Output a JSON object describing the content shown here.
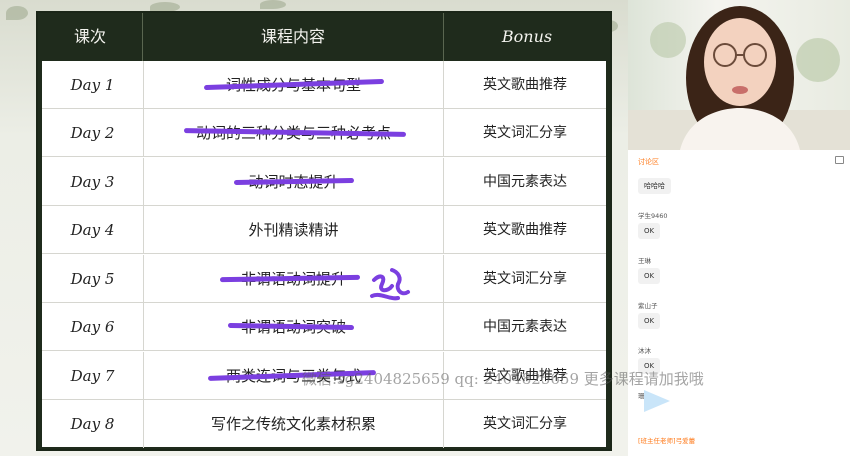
{
  "table": {
    "headers": {
      "session": "课次",
      "content": "课程内容",
      "bonus": "Bonus"
    },
    "rows": [
      {
        "day": "Day 1",
        "content": "词性成分与基本句型",
        "bonus": "英文歌曲推荐",
        "crossed": true
      },
      {
        "day": "Day 2",
        "content": "动词的三种分类与三种必考点",
        "bonus": "英文词汇分享",
        "crossed": true
      },
      {
        "day": "Day 3",
        "content": "动词时态提升",
        "bonus": "中国元素表达",
        "crossed": true
      },
      {
        "day": "Day 4",
        "content": "外刊精读精讲",
        "bonus": "英文歌曲推荐",
        "crossed": false
      },
      {
        "day": "Day 5",
        "content": "非谓语动词提升",
        "bonus": "英文词汇分享",
        "crossed": true
      },
      {
        "day": "Day 6",
        "content": "非谓语动词突破",
        "bonus": "中国元素表达",
        "crossed": true
      },
      {
        "day": "Day 7",
        "content": "两类连词与三类句式",
        "bonus": "英文歌曲推荐",
        "crossed": true
      },
      {
        "day": "Day 8",
        "content": "写作之传统文化素材积累",
        "bonus": "英文词汇分享",
        "crossed": false
      }
    ]
  },
  "annotation_color": "#7b3fe0",
  "watermark": "微信:sg2404825659 qq: 2404825659 更多课程请加我哦",
  "chat": {
    "title": "讨论区",
    "icon": "chat-settings-icon",
    "messages": [
      {
        "name": "",
        "text": "哈哈哈"
      },
      {
        "name": "学生9460",
        "text": "OK"
      },
      {
        "name": "王琳",
        "text": "OK"
      },
      {
        "name": "紫山子",
        "text": "OK"
      },
      {
        "name": "沐沐",
        "text": "OK"
      }
    ],
    "partial_name": "珊",
    "teacher_label": "[班主任老师]弓爱蕾",
    "accent_color": "#ff7a1a"
  }
}
